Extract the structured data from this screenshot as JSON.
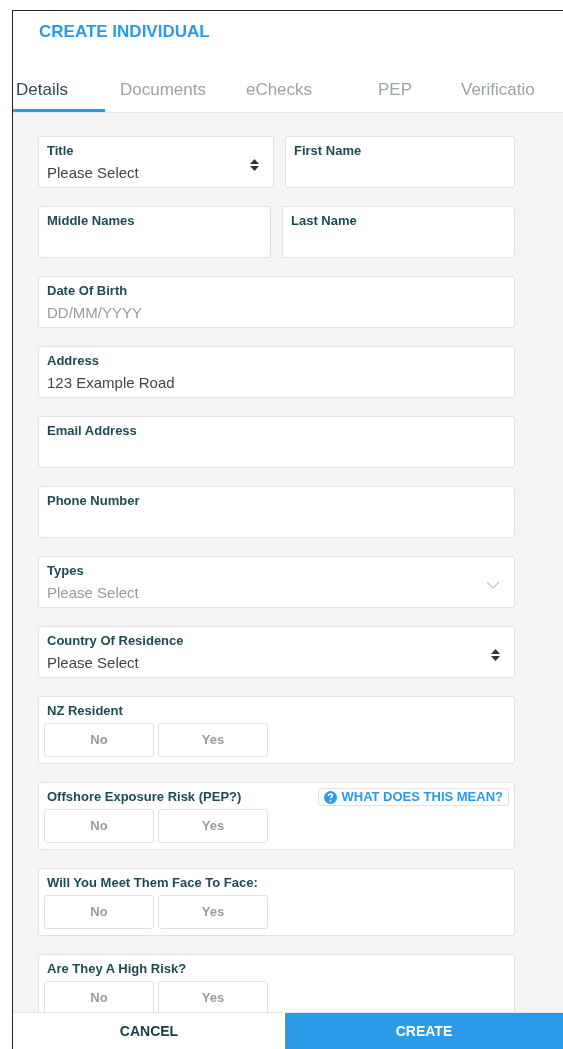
{
  "header": {
    "title": "CREATE INDIVIDUAL"
  },
  "tabs": [
    {
      "label": "Details",
      "selected": true
    },
    {
      "label": "Documents",
      "selected": false
    },
    {
      "label": "eChecks",
      "selected": false
    },
    {
      "label": "PEP",
      "selected": false
    },
    {
      "label": "Verificatio",
      "selected": false
    }
  ],
  "rows": [
    {
      "fields": [
        {
          "kind": "select",
          "label": "Title",
          "value": "Please Select"
        },
        {
          "kind": "text",
          "label": "First Name"
        }
      ]
    },
    {
      "fields": [
        {
          "kind": "text",
          "label": "Middle Names"
        },
        {
          "kind": "text",
          "label": "Last Name"
        }
      ]
    },
    {
      "fields": [
        {
          "kind": "text",
          "label": "Date Of Birth",
          "placeholder": "DD/MM/YYYY"
        }
      ]
    },
    {
      "fields": [
        {
          "kind": "text",
          "label": "Address",
          "value": "123 Example Road"
        }
      ]
    },
    {
      "fields": [
        {
          "kind": "text",
          "label": "Email Address"
        }
      ]
    },
    {
      "fields": [
        {
          "kind": "text",
          "label": "Phone Number"
        }
      ]
    },
    {
      "fields": [
        {
          "kind": "dropdown",
          "label": "Types",
          "placeholder": "Please Select"
        }
      ]
    },
    {
      "fields": [
        {
          "kind": "select",
          "label": "Country Of Residence",
          "value": "Please Select"
        }
      ]
    },
    {
      "fields": [
        {
          "kind": "toggle",
          "label": "NZ Resident",
          "options": [
            {
              "label": "No",
              "selected": false
            },
            {
              "label": "Yes",
              "selected": false
            }
          ]
        }
      ]
    },
    {
      "fields": [
        {
          "kind": "toggle",
          "label": "Offshore Exposure Risk (PEP?)",
          "help": "WHAT DOES THIS MEAN?",
          "options": [
            {
              "label": "No",
              "selected": false
            },
            {
              "label": "Yes",
              "selected": false
            }
          ]
        }
      ]
    },
    {
      "fields": [
        {
          "kind": "toggle",
          "label": "Will You Meet Them Face To Face:",
          "options": [
            {
              "label": "No",
              "selected": false
            },
            {
              "label": "Yes",
              "selected": false
            }
          ]
        }
      ]
    },
    {
      "fields": [
        {
          "kind": "toggle",
          "label": "Are They A High Risk?",
          "options": [
            {
              "label": "No",
              "selected": false
            },
            {
              "label": "Yes",
              "selected": false
            }
          ]
        }
      ]
    }
  ],
  "footer": {
    "cancel": "CANCEL",
    "create": "CREATE"
  }
}
